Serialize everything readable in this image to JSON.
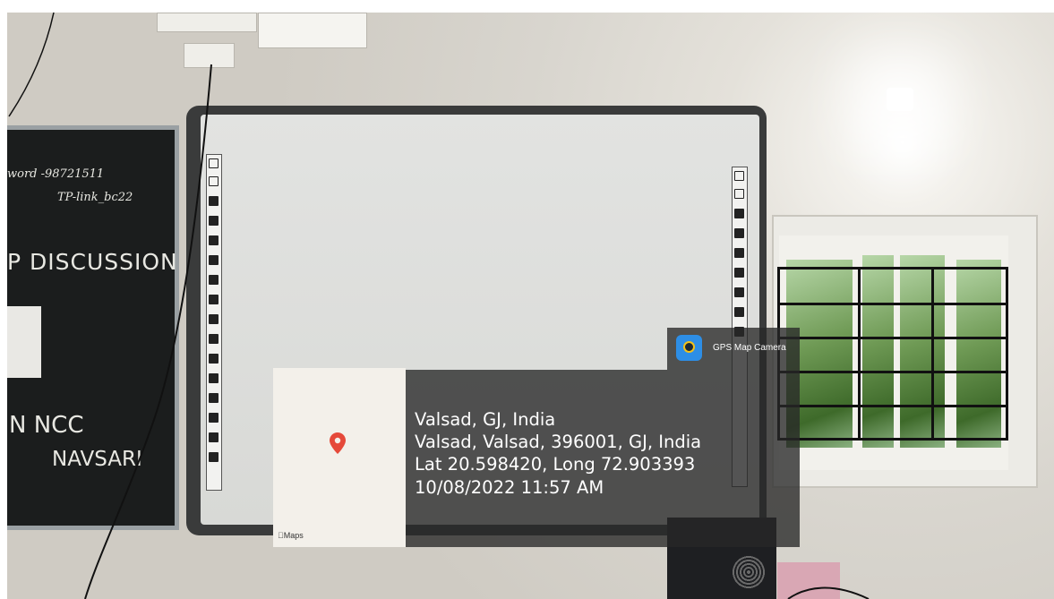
{
  "overlay": {
    "app_name": "GPS Map Camera",
    "maps_label": "Maps",
    "location_title": "Valsad, GJ, India",
    "address": "Valsad, Valsad, 396001, GJ, India",
    "coordinates": "Lat 20.598420, Long 72.903393",
    "datetime": "10/08/2022 11:57 AM"
  },
  "blackboard": {
    "line1": "word  -98721511",
    "line2": "TP-link_bc22",
    "line3": "P DISCUSSION",
    "line4": "N NCC",
    "line5": "NAVSARI"
  },
  "colors": {
    "overlay_bg": "#282828",
    "pin": "#e5493a",
    "app_icon": "#2d8ee6"
  }
}
